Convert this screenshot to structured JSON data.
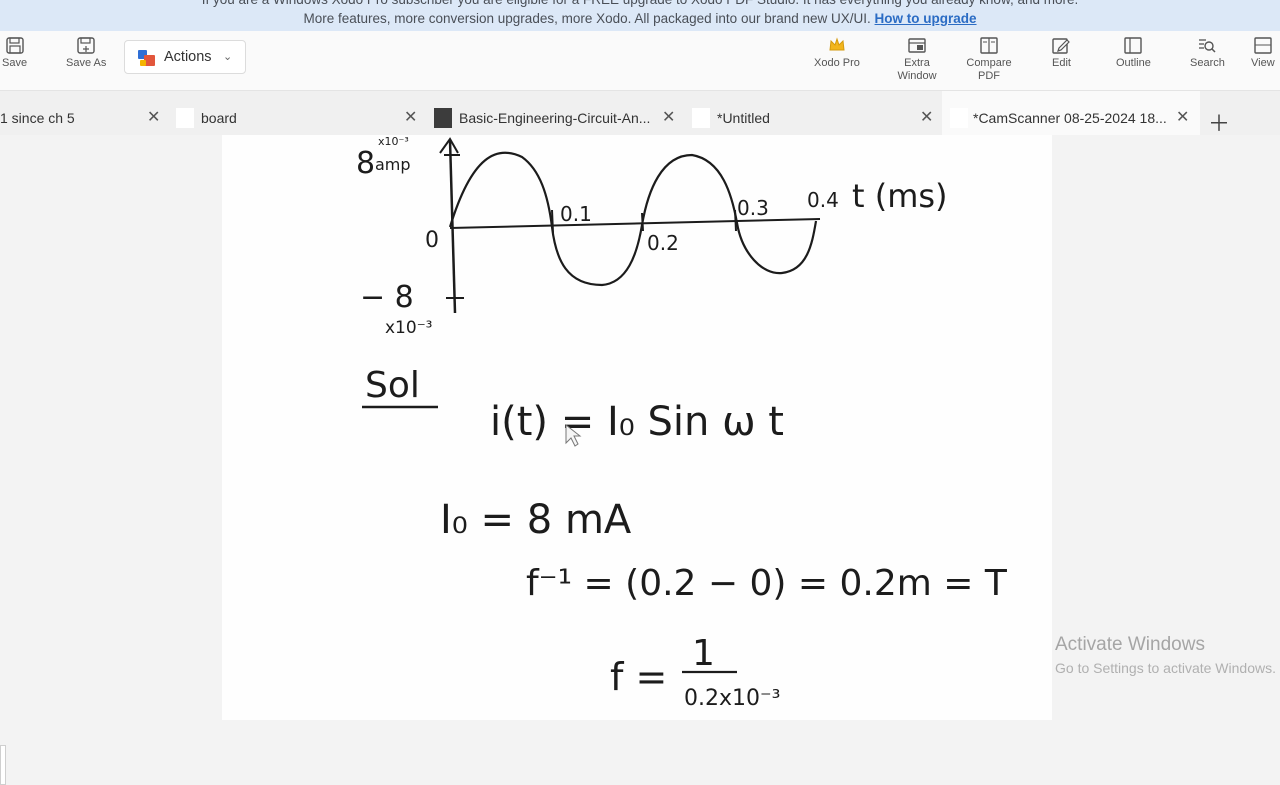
{
  "banner": {
    "line1": "If you are a Windows Xodo Pro subscriber you are eligible for a FREE upgrade to Xodo PDF Studio. It has everything you already know, and more.",
    "line2": "More features, more conversion upgrades, more Xodo. All packaged into our brand new UX/UI.",
    "link": "How to upgrade"
  },
  "toolbar": {
    "save": "Save",
    "save_as": "Save As",
    "actions": "Actions",
    "xodo_pro": "Xodo Pro",
    "extra_window_1": "Extra",
    "extra_window_2": "Window",
    "compare_1": "Compare",
    "compare_2": "PDF",
    "edit": "Edit",
    "outline": "Outline",
    "search": "Search",
    "view": "View"
  },
  "tabs": [
    {
      "label": "1 since ch 5"
    },
    {
      "label": "board"
    },
    {
      "label": "Basic-Engineering-Circuit-An..."
    },
    {
      "label": "*Untitled"
    },
    {
      "label": "*CamScanner 08-25-2024 18..."
    }
  ],
  "document": {
    "y_top": "8",
    "y_top_exp": "x10⁻³",
    "y_top_unit": "amp",
    "y_zero": "0",
    "y_bottom": "− 8",
    "y_bottom_exp": "x10⁻³",
    "x_01": "0.1",
    "x_02": "0.2",
    "x_03": "0.3",
    "x_04": "0.4",
    "x_unit": "t (ms)",
    "sol": "Sol",
    "eq1": "i(t) = I₀ Sin ω t",
    "eq2": "I₀ = 8 mA",
    "eq3": "f⁻¹ = (0.2 − 0) = 0.2m = T",
    "eq4_lhs": "f =",
    "eq4_num": "1",
    "eq4_den": "0.2x10⁻³"
  },
  "watermark": {
    "title": "Activate Windows",
    "subtitle": "Go to Settings to activate Windows."
  },
  "colors": {
    "banner_bg": "#dce8f7",
    "link": "#2b6cc4",
    "ink": "#1c1c1c"
  }
}
